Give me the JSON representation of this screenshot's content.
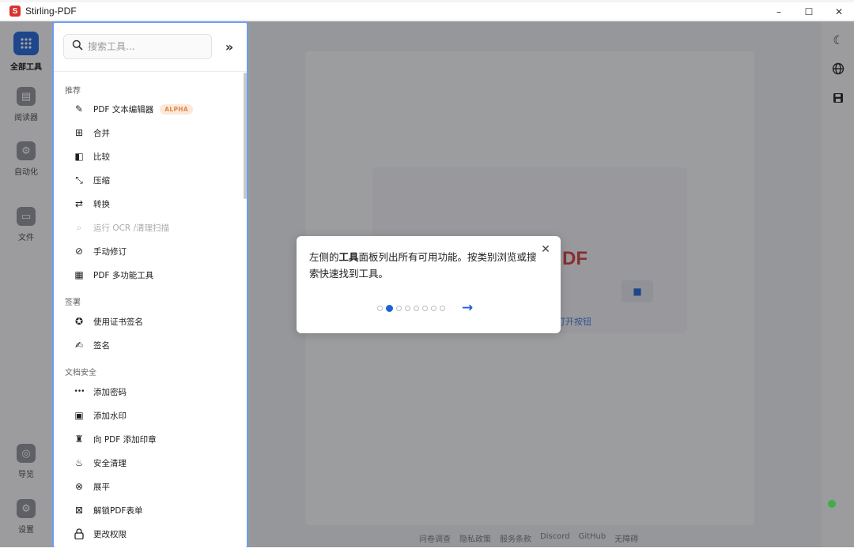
{
  "window": {
    "title": "Stirling-PDF",
    "logo_letter": "S",
    "minimize": "–",
    "maximize": "☐",
    "close": "✕"
  },
  "rail": {
    "items": [
      {
        "label": "全部工具",
        "icon": "grid-icon"
      },
      {
        "label": "阅读器",
        "icon": "book-icon"
      },
      {
        "label": "自动化",
        "icon": "automation-icon"
      },
      {
        "label": "文件",
        "icon": "folder-icon"
      },
      {
        "label": "导览",
        "icon": "tour-icon"
      },
      {
        "label": "设置",
        "icon": "gear-icon"
      }
    ]
  },
  "tools": {
    "search_placeholder": "搜索工具...",
    "collapse_label": "»",
    "sections": [
      {
        "title": "推荐"
      },
      {
        "title": "签署"
      },
      {
        "title": "文档安全"
      }
    ],
    "items": [
      {
        "label": "PDF 文本编辑器",
        "badge": "ALPHA",
        "icon": "✎"
      },
      {
        "label": "合并",
        "icon": "⊞"
      },
      {
        "label": "比较",
        "icon": "◧"
      },
      {
        "label": "压缩",
        "icon": "⤡"
      },
      {
        "label": "转换",
        "icon": "⇄"
      },
      {
        "label": "运行 OCR /清理扫描",
        "icon": "⌕"
      },
      {
        "label": "手动修订",
        "icon": "⊘"
      },
      {
        "label": "PDF 多功能工具",
        "icon": "▦"
      },
      {
        "label": "使用证书签名",
        "icon": "✪"
      },
      {
        "label": "签名",
        "icon": "✍"
      },
      {
        "label": "添加密码",
        "icon": "•••"
      },
      {
        "label": "添加水印",
        "icon": "▣"
      },
      {
        "label": "向 PDF 添加印章",
        "icon": "♜"
      },
      {
        "label": "安全清理",
        "icon": "♨"
      },
      {
        "label": "展平",
        "icon": "⊗"
      },
      {
        "label": "解锁PDF表单",
        "icon": "⊠"
      },
      {
        "label": "更改权限",
        "icon": "🔒"
      }
    ]
  },
  "main": {
    "drop_title": "DF",
    "open_link": "打开按钮",
    "footer": [
      "问卷调查",
      "隐私政策",
      "服务条款",
      "Discord",
      "GitHub",
      "无障碍"
    ]
  },
  "right_rail": {
    "icons": [
      "moon-icon",
      "globe-icon",
      "save-icon"
    ]
  },
  "tour": {
    "text_before": "左侧的",
    "text_bold": "工具",
    "text_after": "面板列出所有可用功能。按类别浏览或搜索快速找到工具。",
    "close_label": "✕",
    "next_label": "→",
    "total_steps": 8,
    "current_step": 2
  },
  "colors": {
    "accent": "#1f62d6",
    "panel_border": "#6f9cf0",
    "brand_red": "#d23a3a",
    "status_green": "#3fae44"
  }
}
